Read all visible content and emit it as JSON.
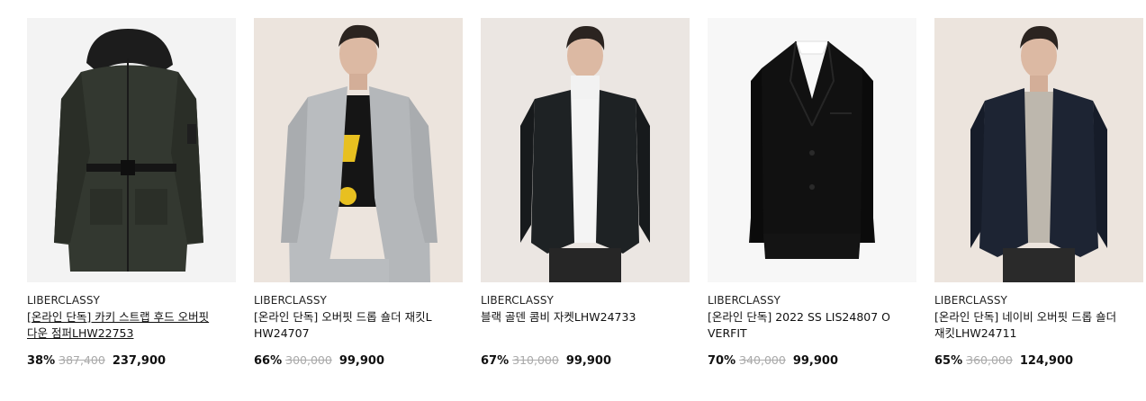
{
  "products": [
    {
      "brand": "LIBERCLASSY",
      "title": "[온라인 단독] 카키 스트랩 후드 오버핏 다운 점퍼LHW22753",
      "discount_rate": "38%",
      "original_price": "387,400",
      "sale_price": "237,900",
      "image_alt": "khaki hooded down jumper with strap belt",
      "colors": {
        "bg": "#f3f3f3",
        "garment": "#333830",
        "trim": "#1c1c1c"
      }
    },
    {
      "brand": "LIBERCLASSY",
      "title": "[온라인 단독] 오버핏 드롭 숄더 재킷LHW24707",
      "discount_rate": "66%",
      "original_price": "300,000",
      "sale_price": "99,900",
      "image_alt": "model in light grey oversized blazer",
      "colors": {
        "bg": "#ece4dd",
        "garment": "#b9bcbf",
        "trim": "#1a1a1a"
      }
    },
    {
      "brand": "LIBERCLASSY",
      "title": "블랙 골덴 콤비 자켓LHW24733",
      "discount_rate": "67%",
      "original_price": "310,000",
      "sale_price": "99,900",
      "image_alt": "model in black corduroy blazer with white turtleneck",
      "colors": {
        "bg": "#ebe6e2",
        "garment": "#1e2224",
        "trim": "#f2f2f2"
      }
    },
    {
      "brand": "LIBERCLASSY",
      "title": "[온라인 단독] 2022 SS LIS24807 OVERFIT",
      "discount_rate": "70%",
      "original_price": "340,000",
      "sale_price": "99,900",
      "image_alt": "black overfit blazer flat",
      "colors": {
        "bg": "#f7f7f7",
        "garment": "#111111",
        "trim": "#ffffff"
      }
    },
    {
      "brand": "LIBERCLASSY",
      "title": "[온라인 단독] 네이비 오버핏 드롭 숄더 재킷LHW24711",
      "discount_rate": "65%",
      "original_price": "360,000",
      "sale_price": "124,900",
      "image_alt": "model in navy oversized blazer",
      "colors": {
        "bg": "#ece4dd",
        "garment": "#1d2433",
        "trim": "#bdb7ad"
      }
    }
  ]
}
